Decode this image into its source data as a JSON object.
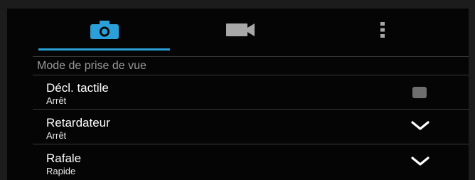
{
  "tabs": [
    {
      "icon": "camera-icon",
      "active": true
    },
    {
      "icon": "video-camera-icon",
      "active": false
    },
    {
      "icon": "more-vertical-icon",
      "active": false
    }
  ],
  "colors": {
    "accent": "#2a9fd8",
    "background": "#050505",
    "divider": "#3a3a3a",
    "checkbox": "#6e6e6e"
  },
  "section": {
    "title": "Mode de prise de vue"
  },
  "settings": [
    {
      "title": "Décl. tactile",
      "value": "Arrêt",
      "control": "checkbox",
      "checked": false
    },
    {
      "title": "Retardateur",
      "value": "Arrêt",
      "control": "dropdown"
    },
    {
      "title": "Rafale",
      "value": "Rapide",
      "control": "dropdown"
    }
  ]
}
